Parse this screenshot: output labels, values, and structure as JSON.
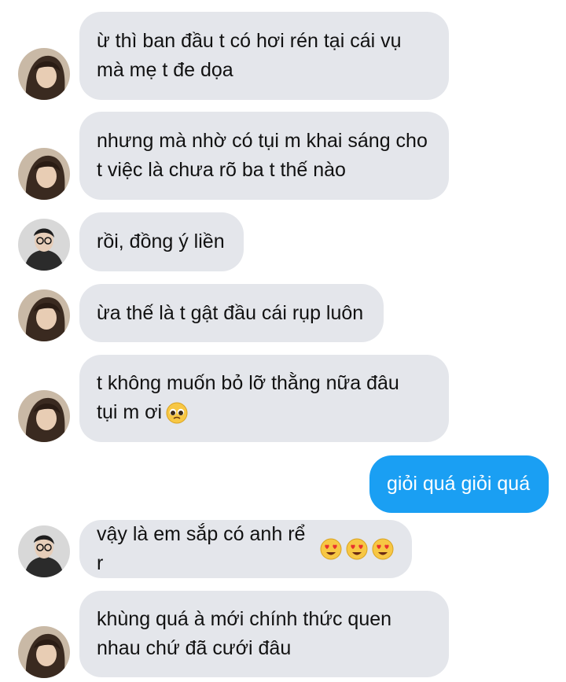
{
  "messages": [
    {
      "sender": "them",
      "avatar": "avatar-long-hair",
      "text": "ừ thì ban đầu t có hơi rén tại cái vụ\nmà mẹ t đe dọa"
    },
    {
      "sender": "them",
      "avatar": "avatar-long-hair",
      "text": "nhưng mà nhờ có tụi m khai sáng cho\nt việc là chưa rõ ba t thế nào"
    },
    {
      "sender": "them",
      "avatar": "avatar-glasses",
      "text": "rồi, đồng ý liền"
    },
    {
      "sender": "them",
      "avatar": "avatar-long-hair",
      "text": "ừa thế là t gật đầu cái rụp luôn"
    },
    {
      "sender": "them",
      "avatar": "avatar-long-hair",
      "text": "t không muốn bỏ lỡ thằng nữa đâu\ntụi m ơi",
      "emoji": [
        "pleading-face-emoji"
      ]
    },
    {
      "sender": "me",
      "text": "giỏi quá giỏi quá"
    },
    {
      "sender": "them",
      "avatar": "avatar-glasses",
      "text": "vậy là em sắp có anh rể r",
      "emoji": [
        "heart-eyes-emoji",
        "heart-eyes-emoji",
        "heart-eyes-emoji"
      ]
    },
    {
      "sender": "them",
      "avatar": "avatar-long-hair",
      "text": "khùng quá à mới chính thức quen\nnhau chứ đã cưới đâu"
    }
  ],
  "colors": {
    "incoming_bubble": "#e4e6eb",
    "outgoing_bubble": "#1a9ff3",
    "background": "#ffffff"
  }
}
